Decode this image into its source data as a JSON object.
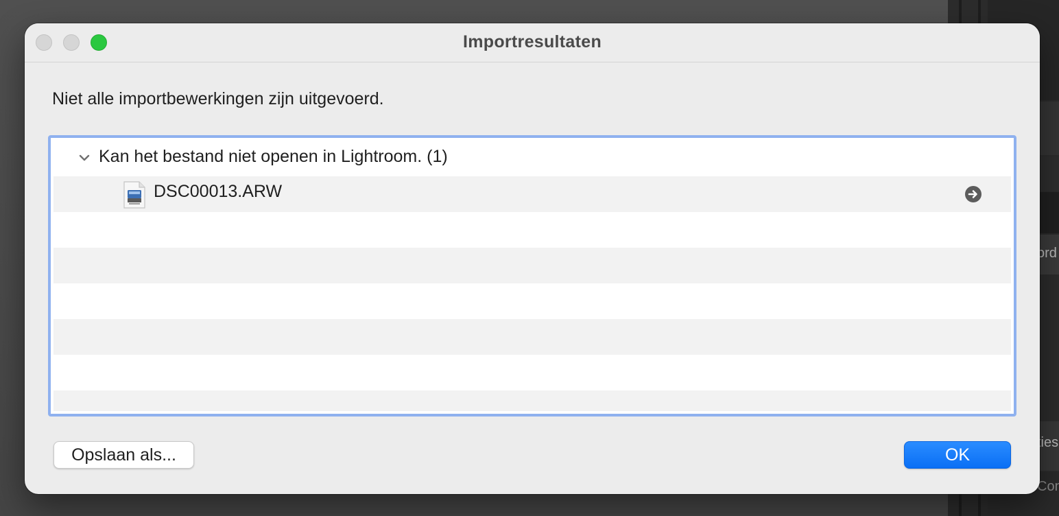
{
  "background_app": {
    "side_text_1": "ord",
    "side_text_2": "ties",
    "side_text_3": "Con"
  },
  "window": {
    "title": "Importresultaten",
    "traffic_lights": [
      "close",
      "minimize",
      "zoom"
    ]
  },
  "message": "Niet alle importbewerkingen zijn uitgevoerd.",
  "results": {
    "groups": [
      {
        "label": "Kan het bestand niet openen in Lightroom. (1)",
        "expanded": true,
        "items": [
          {
            "name": "DSC00013.ARW",
            "icon": "raw-file-icon",
            "action_icon": "arrow-right-circle-icon"
          }
        ]
      }
    ]
  },
  "buttons": {
    "save_as": "Opslaan als...",
    "ok": "OK"
  },
  "colors": {
    "accent": "#0a6ff5",
    "focus_ring": "#8fb1ef",
    "zoom_green": "#2bc840",
    "row_stripe": "#f2f2f2"
  }
}
